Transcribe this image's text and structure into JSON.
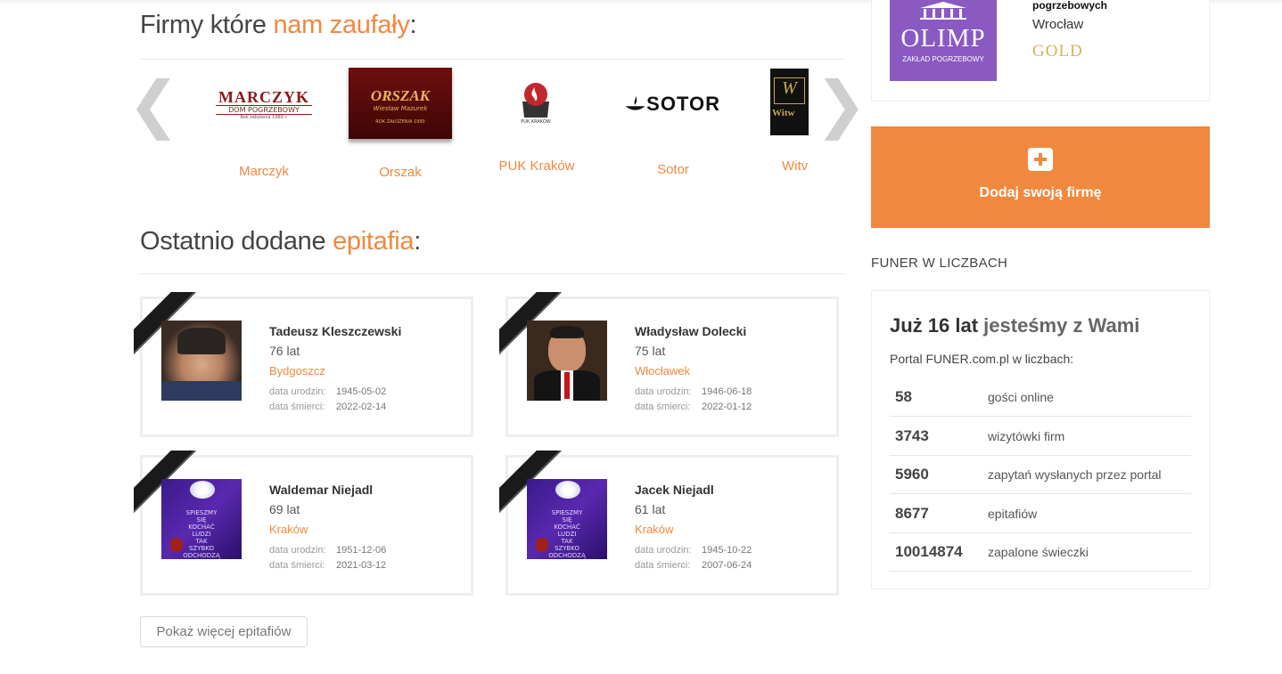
{
  "companies_section": {
    "title_plain": "Firmy które ",
    "title_accent": "nam zaufały",
    "title_colon": ":",
    "prev_arrow": "❮",
    "next_arrow": "❯",
    "companies": [
      {
        "name": "Marczyk",
        "logo_main": "MARCZYK",
        "logo_sub": "DOM POGRZEBOWY",
        "logo_year": "Rok założenia 1989 r."
      },
      {
        "name": "Orszak",
        "logo_main": "ORSZAK",
        "logo_sub": "Wiesław Mazurek",
        "logo_year": "ROK ZAŁOŻENIA 1990"
      },
      {
        "name": "PUK Kraków",
        "logo_sub": "PUK KRAKÓW"
      },
      {
        "name": "Sotor",
        "logo_main": "SOTOR"
      },
      {
        "name": "Witv",
        "logo_main": "Witw"
      }
    ]
  },
  "epitaphs_section": {
    "title_plain": "Ostatnio dodane ",
    "title_accent": "epitafia",
    "title_colon": ":",
    "birth_label": "data urodzin:",
    "death_label": "data śmierci:",
    "cards": [
      {
        "name": "Tadeusz Kleszczewski",
        "age": "76 lat",
        "city": "Bydgoszcz",
        "born": "1945-05-02",
        "died": "2022-02-14",
        "photo": "portrait"
      },
      {
        "name": "Władysław Dolecki",
        "age": "75 lat",
        "city": "Włocławek",
        "born": "1946-06-18",
        "died": "2022-01-12",
        "photo": "portrait"
      },
      {
        "name": "Waldemar Niejadl",
        "age": "69 lat",
        "city": "Kraków",
        "born": "1951-12-06",
        "died": "2021-03-12",
        "photo": "flowers"
      },
      {
        "name": "Jacek Niejadl",
        "age": "61 lat",
        "city": "Kraków",
        "born": "1945-10-22",
        "died": "2007-06-24",
        "photo": "flowers"
      }
    ],
    "photo_caption_lines": [
      "SPIESZMY",
      "SIĘ",
      "KOCHAĆ",
      "LUDZI",
      "TAK",
      "SZYBKO",
      "ODCHODZĄ"
    ],
    "more_button": "Pokaż więcej epitafiów"
  },
  "sidebar": {
    "featured": {
      "logo_title": "OLIMP",
      "logo_sub": "ZAKŁAD POGRZEBOWY",
      "type_line": "pogrzebowych",
      "city": "Wrocław",
      "tier": "GOLD"
    },
    "add_company": {
      "icon": "plus-square-icon",
      "label": "Dodaj swoją firmę"
    },
    "stats_heading": "FUNER W LICZBACH",
    "stats_box": {
      "title_plain": "Już 16 lat ",
      "title_accent": "jesteśmy z Wami",
      "subtitle": "Portal FUNER.com.pl w liczbach:",
      "rows": [
        {
          "num": "58",
          "label": "gości online"
        },
        {
          "num": "3743",
          "label": "wizytówki firm"
        },
        {
          "num": "5960",
          "label": "zapytań wysłanych przez portal"
        },
        {
          "num": "8677",
          "label": "epitafiów"
        },
        {
          "num": "10014874",
          "label": "zapalone świeczki"
        }
      ]
    }
  },
  "colors": {
    "accent": "#f0883e",
    "olimp_purple": "#8a59c2",
    "gold": "#d4b45a"
  }
}
